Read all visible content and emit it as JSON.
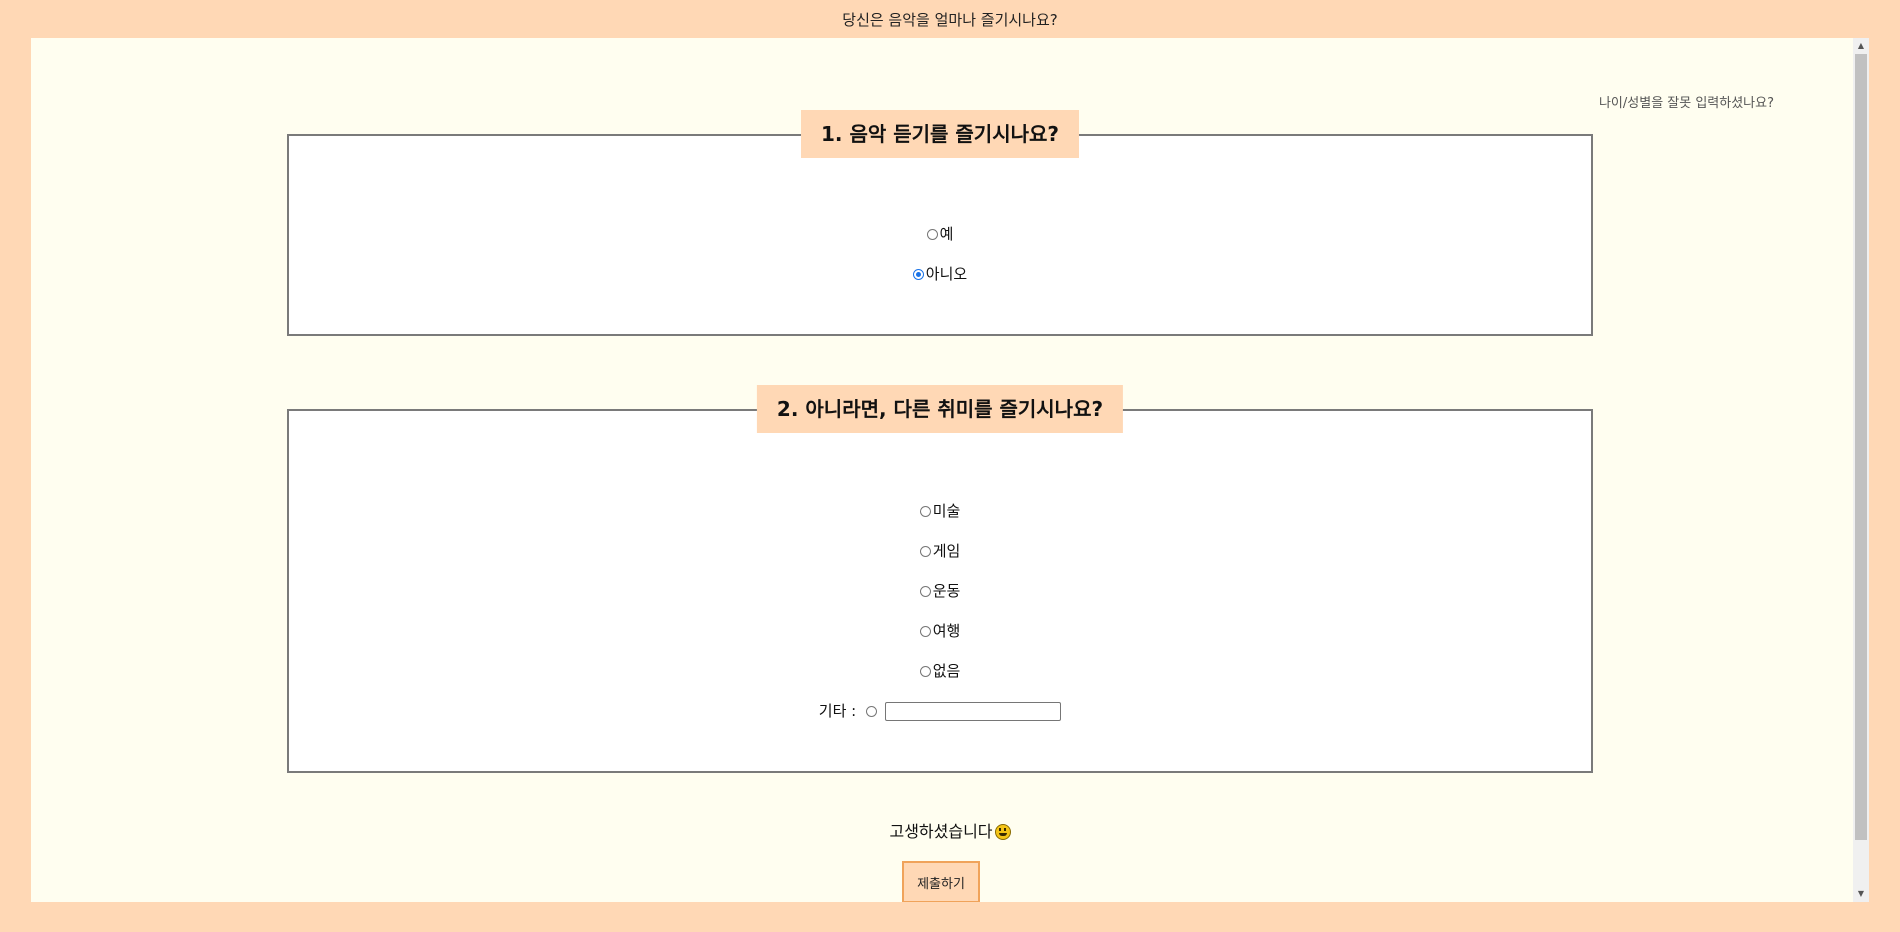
{
  "header": {
    "title": "당신은 음악을 얼마나 즐기시나요?"
  },
  "top_link": "나이/성별을 잘못 입력하셨나요?",
  "question1": {
    "legend": "1. 음악 듣기를 즐기시나요?",
    "options": [
      {
        "label": "예",
        "checked": false
      },
      {
        "label": "아니오",
        "checked": true
      }
    ]
  },
  "question2": {
    "legend": "2. 아니라면, 다른 취미를 즐기시나요?",
    "options": [
      {
        "label": "미술",
        "checked": false
      },
      {
        "label": "게임",
        "checked": false
      },
      {
        "label": "운동",
        "checked": false
      },
      {
        "label": "여행",
        "checked": false
      },
      {
        "label": "없음",
        "checked": false
      }
    ],
    "etc_label": "기타 :",
    "etc_value": ""
  },
  "footer": {
    "thanks": "고생하셨습니다",
    "submit_label": "제출하기"
  },
  "colors": {
    "page_bg": "#ffd8b5",
    "content_bg": "#fffef0",
    "button_border": "#f0a35a",
    "radio_accent": "#1a73e8"
  }
}
